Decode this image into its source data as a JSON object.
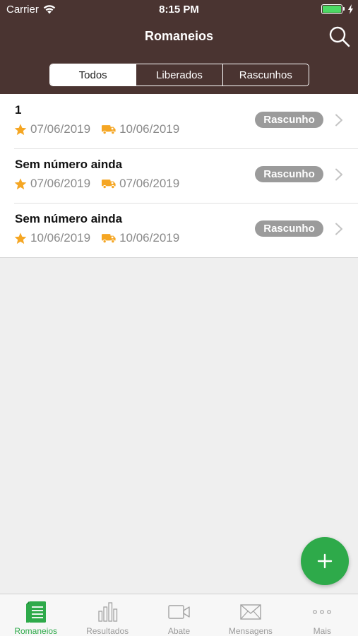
{
  "status_bar": {
    "carrier": "Carrier",
    "time": "8:15 PM"
  },
  "nav": {
    "title": "Romaneios"
  },
  "segments": [
    {
      "label": "Todos",
      "active": true
    },
    {
      "label": "Liberados",
      "active": false
    },
    {
      "label": "Rascunhos",
      "active": false
    }
  ],
  "list": {
    "items": [
      {
        "title": "1",
        "date_star": "07/06/2019",
        "date_truck": "10/06/2019",
        "status": "Rascunho"
      },
      {
        "title": "Sem número ainda",
        "date_star": "07/06/2019",
        "date_truck": "07/06/2019",
        "status": "Rascunho"
      },
      {
        "title": "Sem número ainda",
        "date_star": "10/06/2019",
        "date_truck": "10/06/2019",
        "status": "Rascunho"
      }
    ]
  },
  "fab": {
    "icon": "plus-icon"
  },
  "tabbar": {
    "items": [
      {
        "label": "Romaneios",
        "icon": "document-list-icon",
        "active": true
      },
      {
        "label": "Resultados",
        "icon": "bar-chart-icon",
        "active": false
      },
      {
        "label": "Abate",
        "icon": "video-camera-icon",
        "active": false
      },
      {
        "label": "Mensagens",
        "icon": "envelope-icon",
        "active": false
      },
      {
        "label": "Mais",
        "icon": "more-dots-icon",
        "active": false
      }
    ]
  },
  "colors": {
    "header_bg": "#4a3431",
    "accent_green": "#2eaa4a",
    "star_orange": "#f5a623",
    "badge_gray": "#9b9b9b",
    "battery_green": "#4cd964"
  }
}
